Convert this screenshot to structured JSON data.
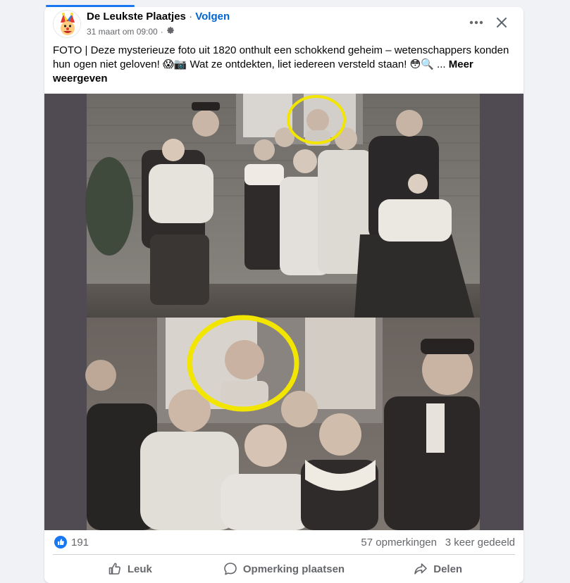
{
  "post": {
    "page_name": "De Leukste Plaatjes",
    "separator": "·",
    "follow_label": "Volgen",
    "timestamp": "31 maart om 09:00",
    "meta_separator": "·",
    "privacy_icon": "gear-icon",
    "text": "FOTO | Deze mysterieuze foto uit 1820 onthult een schokkend geheim – wetenschappers konden hun ogen niet geloven! 😱📷 Wat ze ontdekten, liet iedereen versteld staan! 😳🔍 ...",
    "see_more": "Meer weergeven"
  },
  "header_icons": {
    "more": "more-horizontal-icon",
    "close": "close-icon"
  },
  "stats": {
    "likes": "191",
    "comments": "57 opmerkingen",
    "shares": "3 keer gedeeld"
  },
  "actions": {
    "like_label": "Leuk",
    "comment_label": "Opmerking plaatsen",
    "share_label": "Delen"
  },
  "colors": {
    "accent": "#1877f2",
    "follow": "#0064d1",
    "highlight_circle": "#f2e600",
    "media_background": "#504a52"
  }
}
